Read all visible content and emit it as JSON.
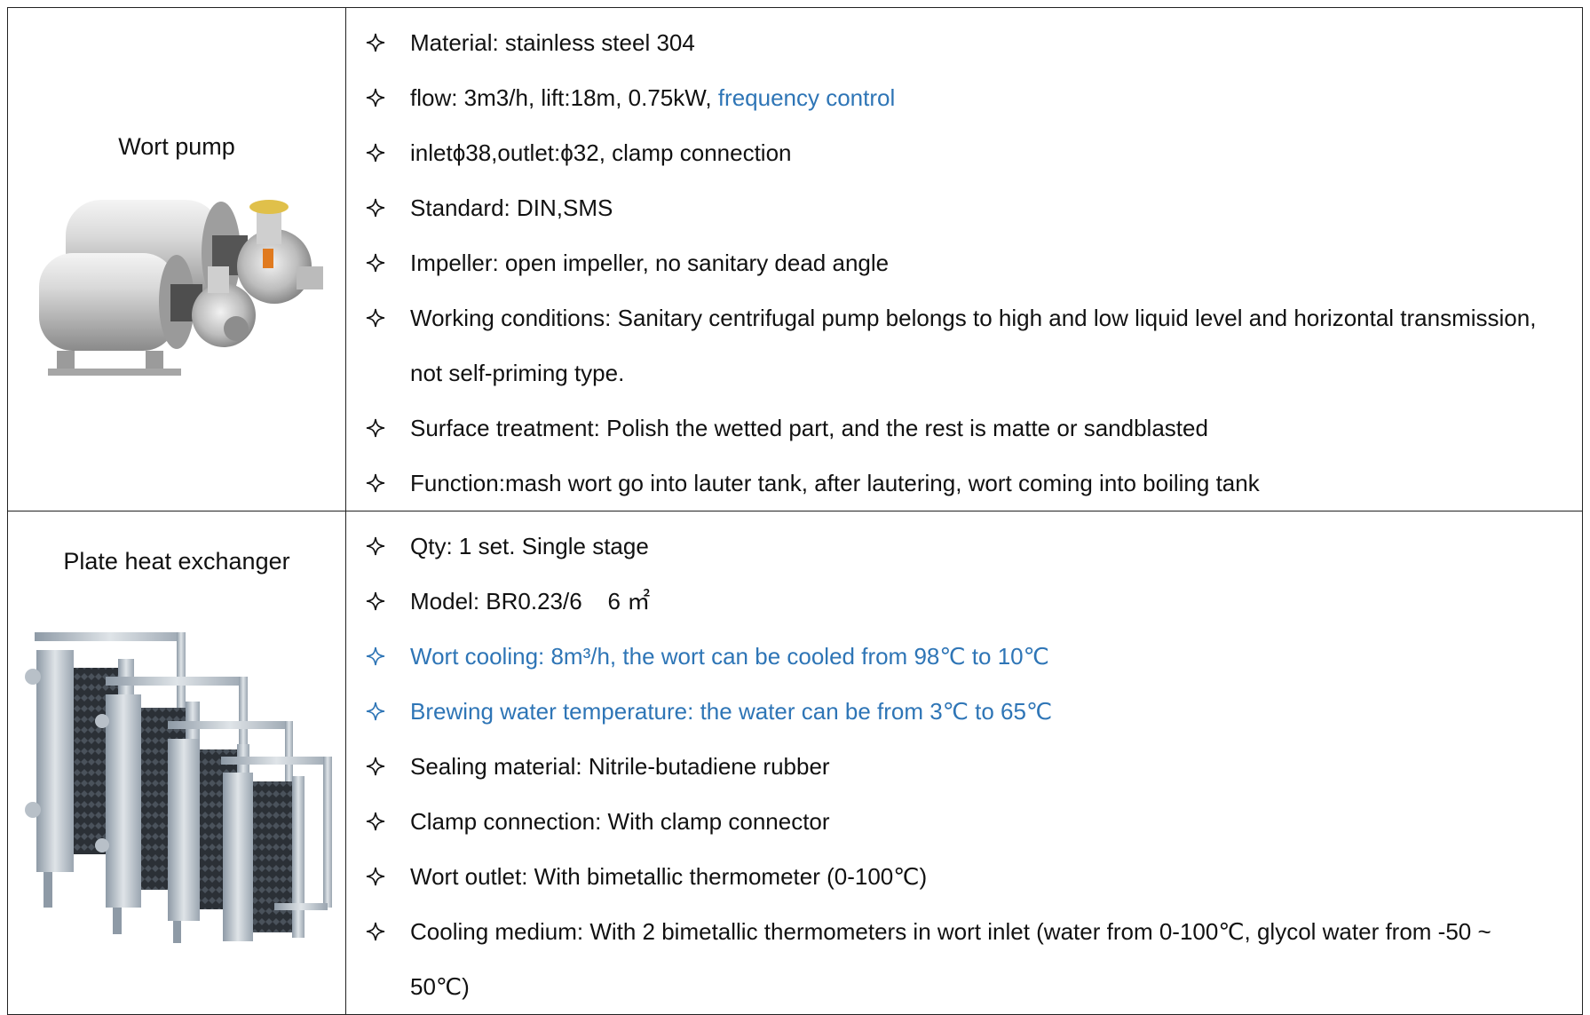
{
  "colors": {
    "border": "#222222",
    "text": "#111111",
    "accent_blue": "#2e75b6"
  },
  "icons": {
    "bullet": "four-point-star-outline-icon"
  },
  "rows": [
    {
      "name": "Wort pump",
      "image_icon": "centrifugal-pump-image",
      "items": [
        {
          "text": "Material: stainless steel 304"
        },
        {
          "text": "flow: 3m3/h, lift:18m, 0.75kW, ",
          "highlight": "frequency control"
        },
        {
          "text": "inletϕ38,outlet:ϕ32, clamp connection"
        },
        {
          "text": "Standard: DIN,SMS"
        },
        {
          "text": "Impeller: open impeller, no sanitary dead angle"
        },
        {
          "text": "Working conditions: Sanitary centrifugal pump belongs to high and low liquid level and horizontal transmission, not self-priming type."
        },
        {
          "text": "Surface treatment: Polish the wetted part, and the rest is matte or sandblasted"
        },
        {
          "text": "Function:mash wort go into lauter tank, after lautering, wort coming into boiling tank"
        }
      ]
    },
    {
      "name": "Plate heat exchanger",
      "image_icon": "plate-heat-exchanger-image",
      "items": [
        {
          "text": "Qty: 1 set. Single stage"
        },
        {
          "text": "Model: BR0.23/6    6 ㎡"
        },
        {
          "text": "Wort cooling: 8m³/h, the wort can be cooled from 98℃ to 10℃",
          "blue": true
        },
        {
          "text": "Brewing water temperature: the water can be from 3℃ to 65℃",
          "blue": true
        },
        {
          "text": "Sealing material: Nitrile-butadiene rubber"
        },
        {
          "text": "Clamp connection: With clamp connector"
        },
        {
          "text": "Wort outlet: With bimetallic thermometer (0-100℃)"
        },
        {
          "text": "Cooling medium: With 2 bimetallic thermometers in wort inlet (water from 0-100℃, glycol water from -50 ~ 50℃)"
        }
      ]
    }
  ]
}
